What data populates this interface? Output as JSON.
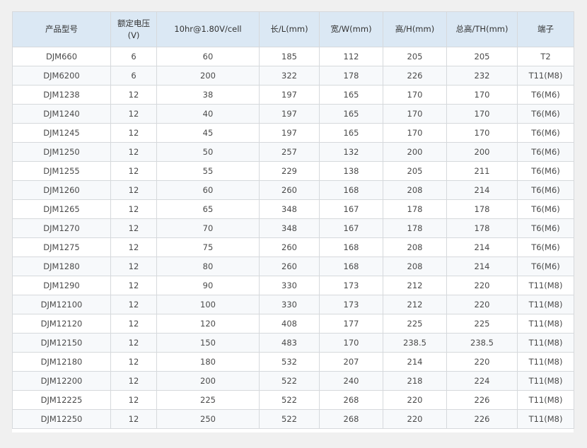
{
  "table": {
    "headers": [
      "产品型号",
      "额定电压(V)",
      "10hr@1.80V/cell",
      "长/L(mm)",
      "宽/W(mm)",
      "高/H(mm)",
      "总高/TH(mm)",
      "端子"
    ],
    "rows": [
      [
        "DJM660",
        "6",
        "60",
        "185",
        "112",
        "205",
        "205",
        "T2"
      ],
      [
        "DJM6200",
        "6",
        "200",
        "322",
        "178",
        "226",
        "232",
        "T11(M8)"
      ],
      [
        "DJM1238",
        "12",
        "38",
        "197",
        "165",
        "170",
        "170",
        "T6(M6)"
      ],
      [
        "DJM1240",
        "12",
        "40",
        "197",
        "165",
        "170",
        "170",
        "T6(M6)"
      ],
      [
        "DJM1245",
        "12",
        "45",
        "197",
        "165",
        "170",
        "170",
        "T6(M6)"
      ],
      [
        "DJM1250",
        "12",
        "50",
        "257",
        "132",
        "200",
        "200",
        "T6(M6)"
      ],
      [
        "DJM1255",
        "12",
        "55",
        "229",
        "138",
        "205",
        "211",
        "T6(M6)"
      ],
      [
        "DJM1260",
        "12",
        "60",
        "260",
        "168",
        "208",
        "214",
        "T6(M6)"
      ],
      [
        "DJM1265",
        "12",
        "65",
        "348",
        "167",
        "178",
        "178",
        "T6(M6)"
      ],
      [
        "DJM1270",
        "12",
        "70",
        "348",
        "167",
        "178",
        "178",
        "T6(M6)"
      ],
      [
        "DJM1275",
        "12",
        "75",
        "260",
        "168",
        "208",
        "214",
        "T6(M6)"
      ],
      [
        "DJM1280",
        "12",
        "80",
        "260",
        "168",
        "208",
        "214",
        "T6(M6)"
      ],
      [
        "DJM1290",
        "12",
        "90",
        "330",
        "173",
        "212",
        "220",
        "T11(M8)"
      ],
      [
        "DJM12100",
        "12",
        "100",
        "330",
        "173",
        "212",
        "220",
        "T11(M8)"
      ],
      [
        "DJM12120",
        "12",
        "120",
        "408",
        "177",
        "225",
        "225",
        "T11(M8)"
      ],
      [
        "DJM12150",
        "12",
        "150",
        "483",
        "170",
        "238.5",
        "238.5",
        "T11(M8)"
      ],
      [
        "DJM12180",
        "12",
        "180",
        "532",
        "207",
        "214",
        "220",
        "T11(M8)"
      ],
      [
        "DJM12200",
        "12",
        "200",
        "522",
        "240",
        "218",
        "224",
        "T11(M8)"
      ],
      [
        "DJM12225",
        "12",
        "225",
        "522",
        "268",
        "220",
        "226",
        "T11(M8)"
      ],
      [
        "DJM12250",
        "12",
        "250",
        "522",
        "268",
        "220",
        "226",
        "T11(M8)"
      ]
    ]
  },
  "colors": {
    "header_bg": "#dbe8f4",
    "border": "#d6d9dc",
    "text": "#4a4a4a",
    "page_bg": "#f0f0f0"
  }
}
